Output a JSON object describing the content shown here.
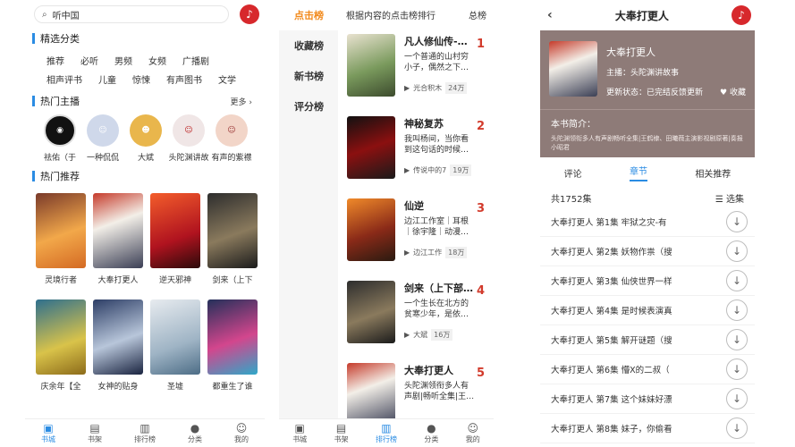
{
  "screen1": {
    "search_text": "听中国",
    "section_categories": "精选分类",
    "categories_row1": [
      "推荐",
      "必听",
      "男频",
      "女频",
      "广播剧"
    ],
    "categories_row2": [
      "相声评书",
      "儿童",
      "惊悚",
      "有声图书",
      "文学"
    ],
    "section_hosts": "热门主播",
    "more": "更多",
    "hosts": [
      "祛佑（于",
      "一种侃侃",
      "大斌",
      "头陀渊讲故",
      "有声的紫襟"
    ],
    "section_hot": "热门推荐",
    "books": [
      "灵境行者",
      "大奉打更人",
      "逆天邪神",
      "剑来（上下",
      "庆余年【全",
      "女神的贴身",
      "圣墟",
      "都重生了谁"
    ]
  },
  "screen2": {
    "side": [
      "点击榜",
      "收藏榜",
      "新书榜",
      "评分榜"
    ],
    "header": "根据内容的点击榜排行",
    "total": "总榜",
    "ranks": [
      {
        "no": "1",
        "name": "凡人修仙传-…",
        "desc": "一个普通的山村穷小子，偶然之下…",
        "author": "光合积木",
        "count": "24万"
      },
      {
        "no": "2",
        "name": "神秘复苏",
        "desc": "我叫杨间，当你看到这句话的时候…",
        "author": "传说中的7",
        "count": "19万"
      },
      {
        "no": "3",
        "name": "仙逆",
        "desc": "边江工作室｜耳根｜徐宇隆｜动漫…",
        "author": "边江工作",
        "count": "18万"
      },
      {
        "no": "4",
        "name": "剑来（上下部…",
        "desc": "一个生长在北方的贫寒少年，是依…",
        "author": "大斌",
        "count": "16万"
      },
      {
        "no": "5",
        "name": "大奉打更人",
        "desc": "头陀渊领衔多人有声剧|畅听全集|王…",
        "author": "",
        "count": ""
      }
    ]
  },
  "screen3": {
    "title": "大奉打更人",
    "book_title": "大奉打更人",
    "anchor": "主播：头陀渊讲故事",
    "update": "更新状态：已完结反馈更新",
    "fav": "收藏",
    "intro_title": "本书简介：",
    "intro": "头陀渊领衔多人有声剧畅听全集|王鹤棣、田曦薇主演影视剧原著|奏报小昭君",
    "tabs": [
      "评论",
      "章节",
      "相关推荐"
    ],
    "count": "共1752集",
    "select": "选集",
    "episodes": [
      "大奉打更人 第1集 牢狱之灾-有",
      "大奉打更人 第2集 妖物作祟（搜",
      "大奉打更人 第3集 仙侠世界一样",
      "大奉打更人 第4集 是时候表演真",
      "大奉打更人 第5集 解开谜题（搜",
      "大奉打更人 第6集 懵X的二叔（",
      "大奉打更人 第7集 这个妹妹好漂",
      "大奉打更人 第8集 妹子，你偷看"
    ]
  },
  "tabbar": [
    "书城",
    "书架",
    "排行榜",
    "分类",
    "我的"
  ],
  "colors": {
    "accent": "#2b8ce3",
    "rank": "#d23a2b",
    "side_active": "#f28a1c",
    "hero": "#8e7b78"
  }
}
